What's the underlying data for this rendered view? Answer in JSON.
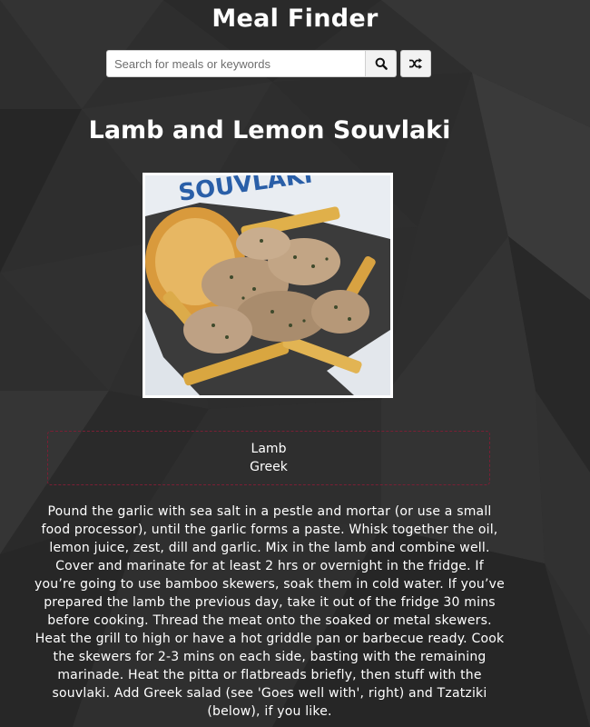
{
  "app": {
    "title": "Meal Finder"
  },
  "search": {
    "placeholder": "Search for meals or keywords",
    "value": "",
    "search_icon": "search-icon",
    "random_icon": "shuffle-icon"
  },
  "meal": {
    "title": "Lamb and Lemon Souvlaki",
    "image_alt": "Lamb and Lemon Souvlaki",
    "image_caption_text": "SOUVLAKI",
    "category": "Lamb",
    "area": "Greek",
    "instructions": "Pound the garlic with sea salt in a pestle and mortar (or use a small food processor), until the garlic forms a paste. Whisk together the oil, lemon juice, zest, dill and garlic. Mix in the lamb and combine well. Cover and marinate for at least 2 hrs or overnight in the fridge. If you’re going to use bamboo skewers, soak them in cold water. If you’ve prepared the lamb the previous day, take it out of the fridge 30 mins before cooking. Thread the meat onto the soaked or metal skewers. Heat the grill to high or have a hot griddle pan or barbecue ready. Cook the skewers for 2-3 mins on each side, basting with the remaining marinade. Heat the pitta or flatbreads briefly, then stuff with the souvlaki. Add Greek salad (see 'Goes well with', right) and Tzatziki (below), if you like."
  },
  "colors": {
    "background": "#2b2b2b",
    "info_border": "#7a1f35",
    "text": "#ffffff"
  }
}
